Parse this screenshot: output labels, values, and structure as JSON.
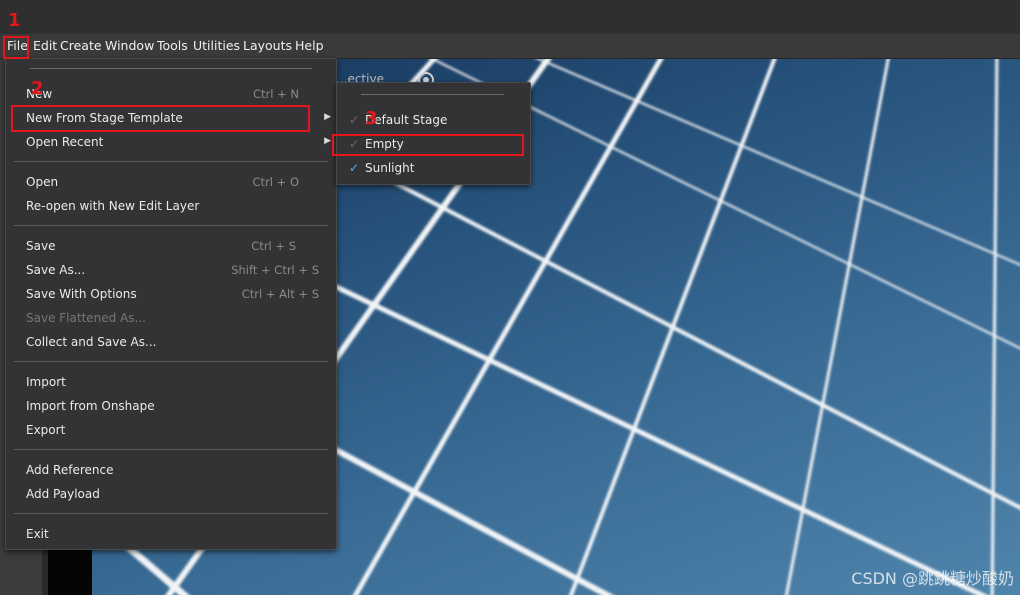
{
  "menubar": [
    "File",
    "Edit",
    "Create",
    "Window",
    "Tools",
    "Utilities",
    "Layouts",
    "Help"
  ],
  "viewport": {
    "label": "...ective"
  },
  "file_menu": {
    "items": [
      {
        "label": "New",
        "shortcut": "Ctrl + N"
      },
      {
        "label": "New From Stage Template",
        "shortcut": ""
      },
      {
        "label": "Open Recent",
        "shortcut": ""
      },
      {
        "label": "Open",
        "shortcut": "Ctrl + O"
      },
      {
        "label": "Re-open with New Edit Layer",
        "shortcut": ""
      },
      {
        "label": "Save",
        "shortcut": "Ctrl + S"
      },
      {
        "label": "Save As...",
        "shortcut": "Shift + Ctrl + S"
      },
      {
        "label": "Save With Options",
        "shortcut": "Ctrl + Alt + S"
      },
      {
        "label": "Save Flattened As...",
        "shortcut": ""
      },
      {
        "label": "Collect and Save As...",
        "shortcut": ""
      },
      {
        "label": "Import",
        "shortcut": ""
      },
      {
        "label": "Import from Onshape",
        "shortcut": ""
      },
      {
        "label": "Export",
        "shortcut": ""
      },
      {
        "label": "Add Reference",
        "shortcut": ""
      },
      {
        "label": "Add Payload",
        "shortcut": ""
      },
      {
        "label": "Exit",
        "shortcut": ""
      }
    ]
  },
  "submenu": {
    "items": [
      {
        "label": "Default Stage",
        "checked": false
      },
      {
        "label": "Empty",
        "checked": false
      },
      {
        "label": "Sunlight",
        "checked": true
      }
    ]
  },
  "annotations": [
    "1",
    "2",
    "3"
  ],
  "watermark": "CSDN @跳跳糖炒酸奶",
  "colors": {
    "highlight": "#e4161c",
    "menu_bg": "#333335",
    "check_active": "#4fb7ff"
  }
}
